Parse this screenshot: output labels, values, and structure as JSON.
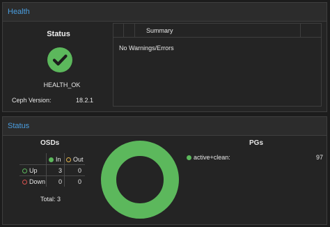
{
  "health": {
    "header": "Health",
    "status_title": "Status",
    "health_status": "HEALTH_OK",
    "ceph_version_label": "Ceph Version:",
    "ceph_version": "18.2.1",
    "status_icon": "check-circle-icon",
    "summary": {
      "column_header": "Summary",
      "rows": [
        "No Warnings/Errors"
      ]
    }
  },
  "status": {
    "header": "Status",
    "osds": {
      "title": "OSDs",
      "col_in": "In",
      "col_out": "Out",
      "row_up": "Up",
      "row_down": "Down",
      "up_in": "3",
      "up_out": "0",
      "down_in": "0",
      "down_out": "0",
      "total": "Total: 3"
    },
    "pgs": {
      "title": "PGs",
      "items": [
        {
          "label": "active+clean:",
          "count": "97",
          "color": "#5cb85c"
        }
      ]
    }
  },
  "colors": {
    "accent": "#4a9ee0",
    "ok": "#5cb85c",
    "warn": "#e0b24c",
    "error": "#d9534f"
  }
}
